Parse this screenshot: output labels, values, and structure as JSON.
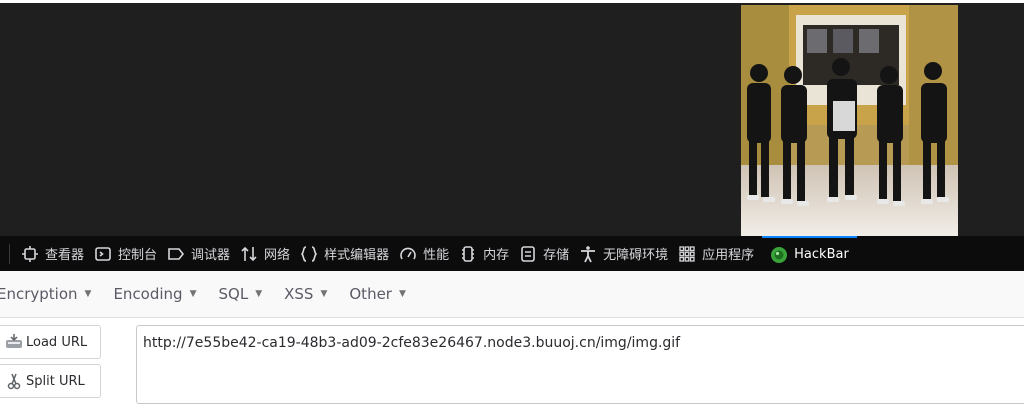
{
  "devtools": {
    "tabs": [
      {
        "label": "查看器",
        "icon": "inspector-icon"
      },
      {
        "label": "控制台",
        "icon": "console-icon"
      },
      {
        "label": "调试器",
        "icon": "debugger-icon"
      },
      {
        "label": "网络",
        "icon": "network-icon"
      },
      {
        "label": "样式编辑器",
        "icon": "style-editor-icon"
      },
      {
        "label": "性能",
        "icon": "performance-icon"
      },
      {
        "label": "内存",
        "icon": "memory-icon"
      },
      {
        "label": "存储",
        "icon": "storage-icon"
      },
      {
        "label": "无障碍环境",
        "icon": "accessibility-icon"
      },
      {
        "label": "应用程序",
        "icon": "application-icon"
      },
      {
        "label": "HackBar",
        "icon": "hackbar-icon",
        "active": true
      }
    ]
  },
  "hackbar": {
    "menu": [
      "Encryption",
      "Encoding",
      "SQL",
      "XSS",
      "Other"
    ],
    "load_url_label": "Load URL",
    "split_url_label": "Split URL",
    "url_value": "http://7e55be42-ca19-48b3-ad09-2cfe83e26467.node3.buuoj.cn/img/img.gif"
  },
  "colors": {
    "page_background": "#1f1f1f",
    "toolbar_background": "#0c0c0d",
    "active_tab_accent": "#0a84ff",
    "hackbar_logo": "#3aa33a"
  }
}
